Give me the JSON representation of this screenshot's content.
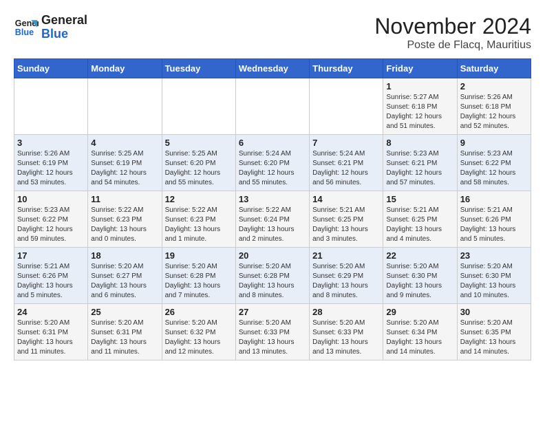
{
  "logo": {
    "line1": "General",
    "line2": "Blue"
  },
  "title": "November 2024",
  "subtitle": "Poste de Flacq, Mauritius",
  "weekdays": [
    "Sunday",
    "Monday",
    "Tuesday",
    "Wednesday",
    "Thursday",
    "Friday",
    "Saturday"
  ],
  "weeks": [
    [
      {
        "day": "",
        "info": ""
      },
      {
        "day": "",
        "info": ""
      },
      {
        "day": "",
        "info": ""
      },
      {
        "day": "",
        "info": ""
      },
      {
        "day": "",
        "info": ""
      },
      {
        "day": "1",
        "info": "Sunrise: 5:27 AM\nSunset: 6:18 PM\nDaylight: 12 hours and 51 minutes."
      },
      {
        "day": "2",
        "info": "Sunrise: 5:26 AM\nSunset: 6:18 PM\nDaylight: 12 hours and 52 minutes."
      }
    ],
    [
      {
        "day": "3",
        "info": "Sunrise: 5:26 AM\nSunset: 6:19 PM\nDaylight: 12 hours and 53 minutes."
      },
      {
        "day": "4",
        "info": "Sunrise: 5:25 AM\nSunset: 6:19 PM\nDaylight: 12 hours and 54 minutes."
      },
      {
        "day": "5",
        "info": "Sunrise: 5:25 AM\nSunset: 6:20 PM\nDaylight: 12 hours and 55 minutes."
      },
      {
        "day": "6",
        "info": "Sunrise: 5:24 AM\nSunset: 6:20 PM\nDaylight: 12 hours and 55 minutes."
      },
      {
        "day": "7",
        "info": "Sunrise: 5:24 AM\nSunset: 6:21 PM\nDaylight: 12 hours and 56 minutes."
      },
      {
        "day": "8",
        "info": "Sunrise: 5:23 AM\nSunset: 6:21 PM\nDaylight: 12 hours and 57 minutes."
      },
      {
        "day": "9",
        "info": "Sunrise: 5:23 AM\nSunset: 6:22 PM\nDaylight: 12 hours and 58 minutes."
      }
    ],
    [
      {
        "day": "10",
        "info": "Sunrise: 5:23 AM\nSunset: 6:22 PM\nDaylight: 12 hours and 59 minutes."
      },
      {
        "day": "11",
        "info": "Sunrise: 5:22 AM\nSunset: 6:23 PM\nDaylight: 13 hours and 0 minutes."
      },
      {
        "day": "12",
        "info": "Sunrise: 5:22 AM\nSunset: 6:23 PM\nDaylight: 13 hours and 1 minute."
      },
      {
        "day": "13",
        "info": "Sunrise: 5:22 AM\nSunset: 6:24 PM\nDaylight: 13 hours and 2 minutes."
      },
      {
        "day": "14",
        "info": "Sunrise: 5:21 AM\nSunset: 6:25 PM\nDaylight: 13 hours and 3 minutes."
      },
      {
        "day": "15",
        "info": "Sunrise: 5:21 AM\nSunset: 6:25 PM\nDaylight: 13 hours and 4 minutes."
      },
      {
        "day": "16",
        "info": "Sunrise: 5:21 AM\nSunset: 6:26 PM\nDaylight: 13 hours and 5 minutes."
      }
    ],
    [
      {
        "day": "17",
        "info": "Sunrise: 5:21 AM\nSunset: 6:26 PM\nDaylight: 13 hours and 5 minutes."
      },
      {
        "day": "18",
        "info": "Sunrise: 5:20 AM\nSunset: 6:27 PM\nDaylight: 13 hours and 6 minutes."
      },
      {
        "day": "19",
        "info": "Sunrise: 5:20 AM\nSunset: 6:28 PM\nDaylight: 13 hours and 7 minutes."
      },
      {
        "day": "20",
        "info": "Sunrise: 5:20 AM\nSunset: 6:28 PM\nDaylight: 13 hours and 8 minutes."
      },
      {
        "day": "21",
        "info": "Sunrise: 5:20 AM\nSunset: 6:29 PM\nDaylight: 13 hours and 8 minutes."
      },
      {
        "day": "22",
        "info": "Sunrise: 5:20 AM\nSunset: 6:30 PM\nDaylight: 13 hours and 9 minutes."
      },
      {
        "day": "23",
        "info": "Sunrise: 5:20 AM\nSunset: 6:30 PM\nDaylight: 13 hours and 10 minutes."
      }
    ],
    [
      {
        "day": "24",
        "info": "Sunrise: 5:20 AM\nSunset: 6:31 PM\nDaylight: 13 hours and 11 minutes."
      },
      {
        "day": "25",
        "info": "Sunrise: 5:20 AM\nSunset: 6:31 PM\nDaylight: 13 hours and 11 minutes."
      },
      {
        "day": "26",
        "info": "Sunrise: 5:20 AM\nSunset: 6:32 PM\nDaylight: 13 hours and 12 minutes."
      },
      {
        "day": "27",
        "info": "Sunrise: 5:20 AM\nSunset: 6:33 PM\nDaylight: 13 hours and 13 minutes."
      },
      {
        "day": "28",
        "info": "Sunrise: 5:20 AM\nSunset: 6:33 PM\nDaylight: 13 hours and 13 minutes."
      },
      {
        "day": "29",
        "info": "Sunrise: 5:20 AM\nSunset: 6:34 PM\nDaylight: 13 hours and 14 minutes."
      },
      {
        "day": "30",
        "info": "Sunrise: 5:20 AM\nSunset: 6:35 PM\nDaylight: 13 hours and 14 minutes."
      }
    ]
  ]
}
